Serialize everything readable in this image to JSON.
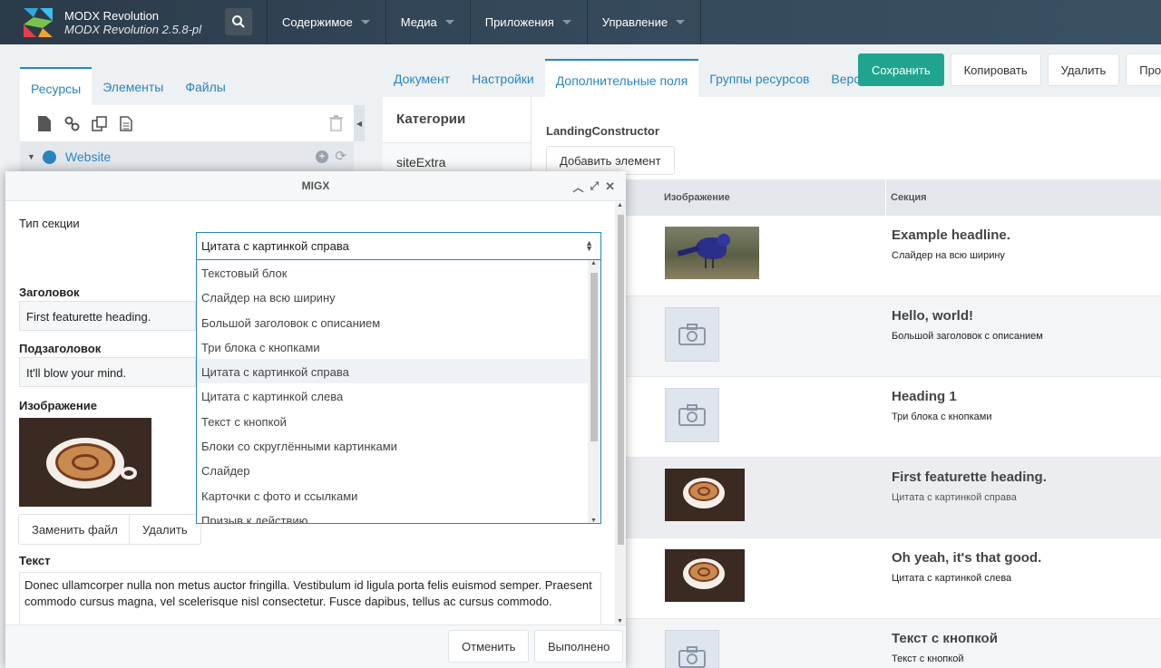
{
  "header": {
    "brand_title": "MODX Revolution",
    "brand_version": "MODX Revolution 2.5.8-pl",
    "menu": [
      "Содержимое",
      "Медиа",
      "Приложения",
      "Управление"
    ]
  },
  "left_panel": {
    "tabs": [
      "Ресурсы",
      "Элементы",
      "Файлы"
    ],
    "tree_root": "Website"
  },
  "main": {
    "tabs": [
      "Документ",
      "Настройки",
      "Дополнительные поля",
      "Группы ресурсов",
      "Верс"
    ],
    "actions": [
      "Сохранить",
      "Копировать",
      "Удалить",
      "Прос"
    ],
    "categories_header": "Категории",
    "category_item": "siteExtra",
    "tv_name": "LandingConstructor",
    "add_element": "Добавить элемент",
    "grid": {
      "columns": [
        "Изображение",
        "Секция"
      ],
      "rows": [
        {
          "title": "Example headline.",
          "section": "Слайдер на всю ширину",
          "image": "bird"
        },
        {
          "title": "Hello, world!",
          "section": "Большой заголовок с описанием",
          "image": "placeholder"
        },
        {
          "title": "Heading 1",
          "section": "Три блока с кнопками",
          "image": "placeholder"
        },
        {
          "title": "First featurette heading.",
          "section": "Цитата с картинкой справа",
          "image": "coffee"
        },
        {
          "title": "Oh yeah, it's that good.",
          "section": "Цитата с картинкой слева",
          "image": "coffee"
        },
        {
          "title": "Текст с кнопкой",
          "section": "Текст с кнопкой",
          "image": "placeholder"
        }
      ]
    }
  },
  "modal": {
    "title": "MIGX",
    "section_type_label": "Тип секции",
    "section_type_value": "Цитата с картинкой справа",
    "options": [
      "Текстовый блок",
      "Слайдер на всю ширину",
      "Большой заголовок с описанием",
      "Три блока с кнопками",
      "Цитата с картинкой справа",
      "Цитата с картинкой слева",
      "Текст с кнопкой",
      "Блоки со скруглёнными картинками",
      "Слайдер",
      "Карточки с фото и ссылками",
      "Призыв к действию"
    ],
    "heading_label": "Заголовок",
    "heading_value": "First featurette heading.",
    "subheading_label": "Подзаголовок",
    "subheading_value": "It'll blow your mind.",
    "image_label": "Изображение",
    "replace_file": "Заменить файл",
    "delete": "Удалить",
    "text_label": "Текст",
    "text_value": "Donec ullamcorper nulla non metus auctor fringilla. Vestibulum id ligula porta felis euismod semper. Praesent commodo cursus magna, vel scelerisque nisl consectetur. Fusce dapibus, tellus ac cursus commodo.",
    "cancel": "Отменить",
    "done": "Выполнено"
  },
  "colors": {
    "accent": "#2a84c2",
    "primary": "#1fa58f",
    "topbar": "#2b3a48"
  }
}
